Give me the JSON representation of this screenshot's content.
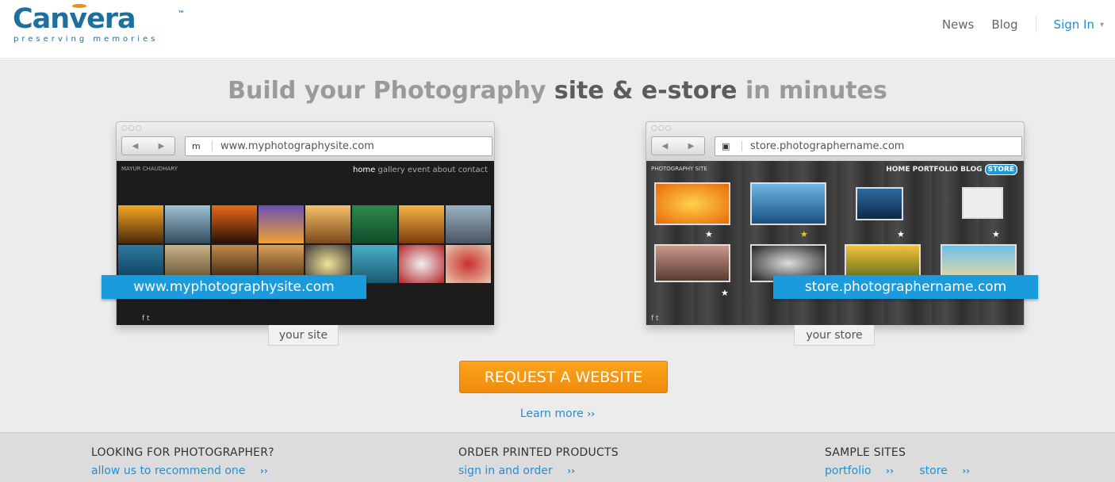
{
  "header": {
    "logo_text_a": "Can",
    "logo_text_v": "v",
    "logo_text_b": "era",
    "logo_tm": "™",
    "logo_tagline": "preserving memories",
    "nav_news": "News",
    "nav_blog": "Blog",
    "nav_signin": "Sign In",
    "caret": "▾"
  },
  "hero": {
    "title_a": "Build your Photography ",
    "title_site": "site",
    "title_and": " & ",
    "title_store": "e-store",
    "title_b": " in minutes",
    "left_browser": {
      "dots": "○○○",
      "nav": [
        "◀",
        "▶"
      ],
      "url": "www.myphotographysite.com",
      "favicon": "m",
      "site_brand": "MAYUR CHAUDHARY",
      "menu_current": "home",
      "menu_rest": " gallery  event  about  contact",
      "social": "f  t"
    },
    "right_browser": {
      "dots": "○○○",
      "nav": [
        "◀",
        "▶"
      ],
      "url": "store.photographername.com",
      "favicon": "▣",
      "site_brand": "PHOTOGRAPHY SITE",
      "menu": "HOME  PORTFOLIO  BLOG",
      "menu_store": "STORE",
      "social": "f  t"
    },
    "left_banner": "www.myphotographysite.com",
    "right_banner": "store.photographername.com",
    "left_tab": "your site",
    "right_tab": "your store",
    "cta": "REQUEST A WEBSITE",
    "learn_more": "Learn more",
    "chevron": "››"
  },
  "footer": {
    "col1_title": "LOOKING FOR PHOTOGRAPHER?",
    "col1_link": "allow us to recommend one",
    "col2_title": "ORDER PRINTED PRODUCTS",
    "col2_link": "sign in and order",
    "col3_title": "SAMPLE SITES",
    "col3_link1": "portfolio",
    "col3_link2": "store",
    "chevron": "››"
  },
  "colors": {
    "brand_blue": "#1d6f9e",
    "link_blue": "#1f8fd6",
    "banner_blue": "#1a9bde",
    "cta_orange": "#f39213"
  }
}
